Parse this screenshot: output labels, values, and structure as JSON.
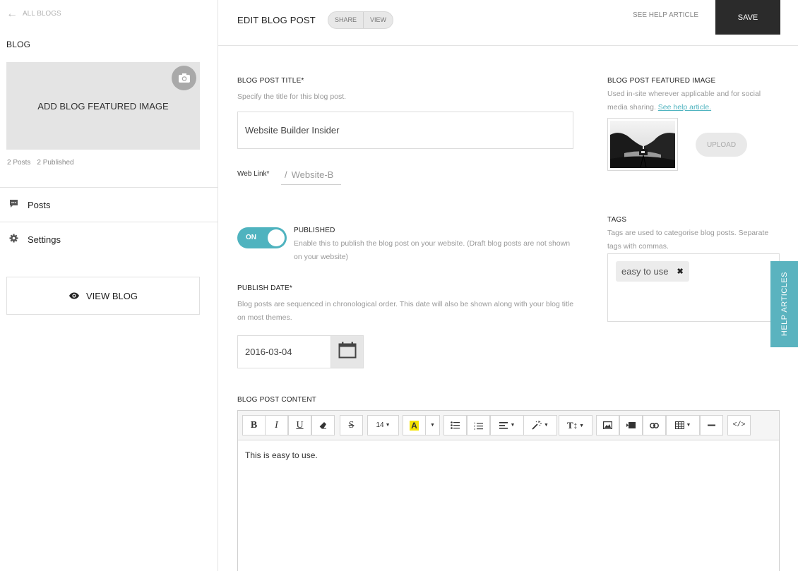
{
  "sidebar": {
    "back_link": "ALL BLOGS",
    "section_title": "BLOG",
    "featured_image_label": "ADD BLOG FEATURED IMAGE",
    "stats": {
      "posts": "2 Posts",
      "published": "2 Published"
    },
    "nav": [
      {
        "label": "Posts",
        "icon": "comment-icon"
      },
      {
        "label": "Settings",
        "icon": "gear-icon"
      }
    ],
    "view_blog_label": "VIEW BLOG"
  },
  "header": {
    "title": "EDIT BLOG POST",
    "share_label": "SHARE",
    "view_label": "VIEW",
    "help_article": "SEE HELP ARTICLE",
    "save_label": "SAVE"
  },
  "form": {
    "title_label": "BLOG POST TITLE*",
    "title_hint": "Specify the title for this blog post.",
    "title_value": "Website Builder Insider",
    "weblink_label": "Web Link*",
    "weblink_slash": "/",
    "weblink_value": "Website-B",
    "published_toggle": "ON",
    "published_label": "PUBLISHED",
    "published_hint": "Enable this to publish the blog post on your website. (Draft blog posts are not shown on your website)",
    "date_label": "PUBLISH DATE*",
    "date_hint": "Blog posts are sequenced in chronological order. This date will also be shown along with your blog title on most themes.",
    "date_value": "2016-03-04",
    "content_label": "BLOG POST CONTENT",
    "content_text": "This is easy to use.",
    "font_size": "14"
  },
  "featured": {
    "label": "BLOG POST FEATURED IMAGE",
    "hint": "Used in-site wherever applicable and for social media sharing.",
    "hint_link": "See help article.",
    "upload_label": "UPLOAD"
  },
  "tags": {
    "label": "TAGS",
    "hint": "Tags are used to categorise blog posts. Separate tags with commas.",
    "items": [
      "easy to use"
    ]
  },
  "help_tab": "HELP ARTICLES",
  "colors": {
    "accent": "#4fb3bf",
    "save_bg": "#2b2b2b",
    "highlight": "#f5e400"
  }
}
